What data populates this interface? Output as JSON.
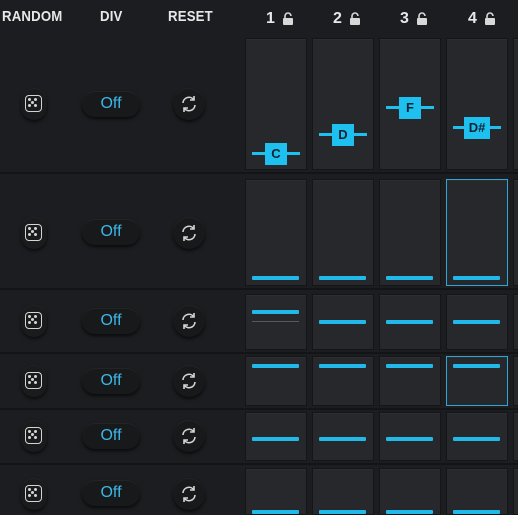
{
  "header": {
    "random_label": "RANDOM",
    "div_label": "DIV",
    "reset_label": "RESET",
    "columns": [
      "1",
      "2",
      "3",
      "4"
    ]
  },
  "rows": [
    {
      "div_value": "Off"
    },
    {
      "div_value": "Off"
    },
    {
      "div_value": "Off"
    },
    {
      "div_value": "Off"
    },
    {
      "div_value": "Off"
    },
    {
      "div_value": "Off"
    }
  ],
  "notes": [
    "C",
    "D",
    "F",
    "D#"
  ],
  "colors": {
    "accent": "#22b8ea",
    "background": "#1c1d20",
    "cell": "#27282b",
    "text": "#e8e8e8"
  },
  "icons": {
    "random": "dice-icon",
    "reset": "refresh-icon",
    "column_lock": "lock-open-icon"
  }
}
